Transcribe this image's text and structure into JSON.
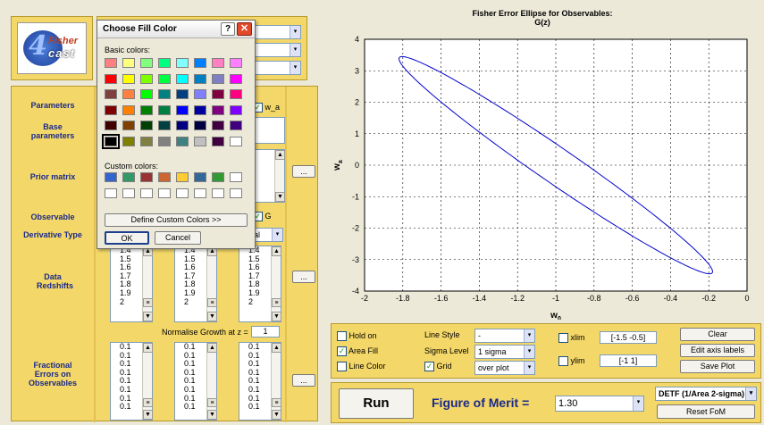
{
  "dialog": {
    "title": "Choose Fill Color",
    "basic_label": "Basic colors:",
    "custom_label": "Custom colors:",
    "define_button": "Define Custom Colors >>",
    "ok": "OK",
    "cancel": "Cancel",
    "basic_colors": [
      "#ff8080",
      "#ffff80",
      "#80ff80",
      "#00ff80",
      "#80ffff",
      "#0080ff",
      "#ff80c0",
      "#ff80ff",
      "#ff0000",
      "#ffff00",
      "#80ff00",
      "#00ff40",
      "#00ffff",
      "#0080c0",
      "#8080c0",
      "#ff00ff",
      "#804040",
      "#ff8040",
      "#00ff00",
      "#008080",
      "#004080",
      "#8080ff",
      "#800040",
      "#ff0080",
      "#800000",
      "#ff8000",
      "#008000",
      "#008040",
      "#0000ff",
      "#0000a0",
      "#800080",
      "#8000ff",
      "#400000",
      "#804000",
      "#004000",
      "#004040",
      "#000080",
      "#000040",
      "#400040",
      "#400080",
      "#000000",
      "#808000",
      "#808040",
      "#808080",
      "#408080",
      "#c0c0c0",
      "#400040",
      "#ffffff"
    ],
    "custom_colors": [
      "#3366cc",
      "#339966",
      "#993333",
      "#cc6633",
      "#ffcc33",
      "#336699",
      "#339933",
      "#ffffff",
      "#ffffff",
      "#ffffff",
      "#ffffff",
      "#ffffff",
      "#ffffff",
      "#ffffff",
      "#ffffff",
      "#ffffff"
    ]
  },
  "logo": {
    "line1": "Fisher",
    "line2": "cast",
    "digit": "4"
  },
  "left": {
    "parameters": "Parameters",
    "base_parameters": "Base parameters",
    "prior_matrix": "Prior matrix",
    "observable": "Observable",
    "derivative_type": "Derivative Type",
    "data_redshifts": "Data Redshifts",
    "fractional_errors": "Fractional Errors on Observables",
    "wa_checkbox": "w_a",
    "g_checkbox": "G",
    "derivative_value": "tical",
    "ellipsis": "...",
    "normalise_label": "Normalise Growth at z =",
    "normalise_value": "1",
    "redshift_items": [
      "1.4",
      "1.5",
      "1.6",
      "1.7",
      "1.8",
      "1.9",
      "2"
    ],
    "error_items": [
      "0.1",
      "0.1",
      "0.1",
      "0.1",
      "0.1",
      "0.1",
      "0.1",
      "0.1"
    ]
  },
  "chart_data": {
    "type": "line",
    "title": "Fisher Error Ellipse for Observables:",
    "subtitle": "G(z)",
    "xlabel": "w",
    "xlabel_sub": "0",
    "ylabel": "w",
    "ylabel_sub": "a",
    "xlim": [
      -2,
      0
    ],
    "ylim": [
      -4,
      4
    ],
    "xticks": [
      "-2",
      "-1.8",
      "-1.6",
      "-1.4",
      "-1.2",
      "-1",
      "-0.8",
      "-0.6",
      "-0.4",
      "-0.2",
      "0"
    ],
    "yticks": [
      "4",
      "3",
      "2",
      "1",
      "0",
      "-1",
      "-2",
      "-3",
      "-4"
    ],
    "grid": true,
    "ellipse": {
      "center_x": -1.0,
      "center_y": 0.0,
      "x_extent": [
        -1.82,
        -0.18
      ],
      "y_extent": [
        -3.45,
        3.45
      ]
    },
    "color": "#0000cc"
  },
  "controls": {
    "hold_on": "Hold on",
    "area_fill": "Area Fill",
    "line_color": "Line Color",
    "line_style_label": "Line Style",
    "line_style_value": "-",
    "sigma_label": "Sigma Level",
    "sigma_value": "1 sigma",
    "grid_label": "Grid",
    "grid_value": "over plot",
    "xlim_label": "xlim",
    "xlim_value": "[-1.5 -0.5]",
    "ylim_label": "ylim",
    "ylim_value": "[-1 1]",
    "clear": "Clear",
    "edit_axis": "Edit axis labels",
    "save_plot": "Save Plot"
  },
  "bottom": {
    "run": "Run",
    "fom_label": "Figure of Merit  =",
    "fom_value": "1.30",
    "detf": "DETF (1/Area 2-sigma)",
    "reset": "Reset FoM"
  }
}
